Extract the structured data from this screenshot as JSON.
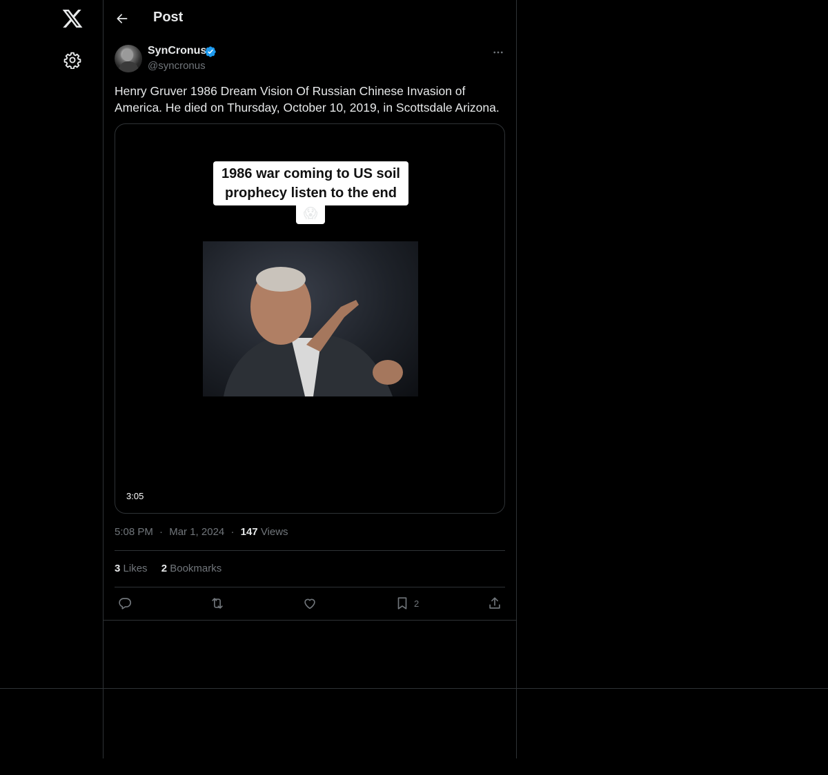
{
  "nav": {
    "logo_icon": "x-logo-icon",
    "settings_icon": "gear-icon"
  },
  "header": {
    "title": "Post",
    "back_icon": "arrow-left-icon"
  },
  "post": {
    "author": {
      "name": "SynCronus",
      "handle": "@syncronus",
      "verified_icon": "verified-badge-icon"
    },
    "more_icon": "more-horizontal-icon",
    "text": "Henry Gruver 1986 Dream Vision Of Russian Chinese Invasion of America. He died on Thursday, October 10, 2019, in Scottsdale Arizona.",
    "media": {
      "caption": "1986 war coming to US soil prophecy listen to the end",
      "caption_emoji": "😱",
      "duration": "3:05"
    },
    "meta": {
      "time": "5:08 PM",
      "separator": "·",
      "date": "Mar 1, 2024",
      "views_count": "147",
      "views_label": "Views"
    },
    "stats": {
      "likes_count": "3",
      "likes_label": "Likes",
      "bookmarks_count": "2",
      "bookmarks_label": "Bookmarks"
    },
    "actions": {
      "reply_icon": "reply-icon",
      "repost_icon": "repost-icon",
      "like_icon": "heart-icon",
      "bookmark_icon": "bookmark-icon",
      "bookmark_count": "2",
      "share_icon": "share-icon"
    }
  },
  "colors": {
    "background": "#000000",
    "text_primary": "#e7e9ea",
    "text_secondary": "#71767b",
    "border": "#2f3336",
    "verified_blue": "#1d9bf0"
  }
}
